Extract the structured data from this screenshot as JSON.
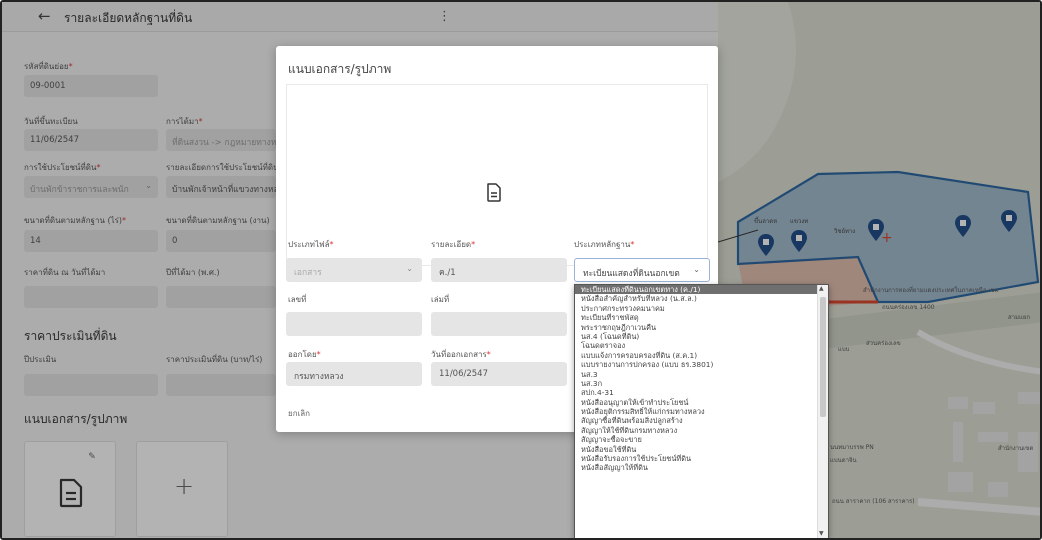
{
  "header": {
    "back_icon": "arrow-left-icon",
    "title": "รายละเอียดหลักฐานที่ดิน",
    "more_icon": "more-vertical-icon"
  },
  "form": {
    "parcel_code": {
      "label": "รหัสที่ดินย่อย",
      "value": "09-0001"
    },
    "register_date": {
      "label": "วันที่ขึ้นทะเบียน",
      "value": "11/06/2547"
    },
    "acquisition": {
      "label": "การได้มา",
      "value": "ที่ดินสงวน -> กฎหมายทางหลวง"
    },
    "land_use": {
      "label": "การใช้ประโยชน์ที่ดิน",
      "value": "บ้านพักข้าราชการและพนัก"
    },
    "land_use_detail": {
      "label": "รายละเอียดการใช้ประโยชน์ที่ดิน",
      "value": "บ้านพักเจ้าหน้าที่แขวงทางหลว"
    },
    "area_rai": {
      "label": "ขนาดที่ดินตามหลักฐาน (ไร่)",
      "value": "14"
    },
    "area_ngan": {
      "label": "ขนาดที่ดินตามหลักฐาน (งาน)",
      "value": "0"
    },
    "price_at_acq": {
      "label": "ราคาที่ดิน ณ วันที่ได้มา",
      "value": ""
    },
    "acq_year": {
      "label": "ปีที่ได้มา (พ.ศ.)",
      "value": ""
    },
    "appraisal_section": "ราคาประเมินที่ดิน",
    "appraisal_year": {
      "label": "ปีประเมิน",
      "value": ""
    },
    "appraisal_price": {
      "label": "ราคาประเมินที่ดิน (บาท/ไร่)",
      "value": ""
    },
    "attachments_section": "แนบเอกสาร/รูปภาพ",
    "doc_icon": "document-icon",
    "edit_icon": "pencil-icon",
    "add_icon": "plus-icon",
    "add_label": "+"
  },
  "dialog": {
    "title": "แนบเอกสาร/รูปภาพ",
    "preview_icon": "document-icon",
    "file_type": {
      "label": "ประเภทไฟล์",
      "value": "เอกสาร"
    },
    "detail": {
      "label": "รายละเอียด",
      "value": "ค./1"
    },
    "doc_type": {
      "label": "ประเภทหลักฐาน",
      "value": "ทะเบียนแสดงที่ดินนอกเขต"
    },
    "number": {
      "label": "เลขที่",
      "value": ""
    },
    "volume": {
      "label": "เล่มที่",
      "value": ""
    },
    "issued_by": {
      "label": "ออกโดย",
      "value": "กรมทางหลวง"
    },
    "issue_date": {
      "label": "วันที่ออกเอกสาร",
      "value": "11/06/2547"
    },
    "cancel": "ยกเลิก"
  },
  "dropdown": {
    "selected_index": 0,
    "options": [
      "ทะเบียนแสดงที่ดินนอกเขตทาง (ค./1)",
      "หนังสือสำคัญสำหรับที่หลวง (น.ส.ล.)",
      "ประกาศกระทรวงคมนาคม",
      "ทะเบียนที่ราชพัสดุ",
      "พระราชกฤษฎีกาเวนคืน",
      "นส.4 (โฉนดที่ดิน)",
      "โฉนดตราจอง",
      "แบบแจ้งการครอบครองที่ดิน (ส.ค.1)",
      "แบบรายงานการปกครอง (แบบ ธร.3801)",
      "นส.3",
      "นส.3ก",
      "สปก.4-31",
      "หนังสืออนุญาตให้เข้าทำประโยชน์",
      "หนังสือยุติกรรมสิทธิ์ให้แก่กรมทางหลวง",
      "สัญญาซื้อที่ดินพร้อมสิ่งปลูกสร้าง",
      "สัญญาให้ใช้ที่ดินกรมทางหลวง",
      "สัญญาจะซื้อจะขาย",
      "หนังสือขอใช้ที่ดิน",
      "หนังสือรับรองการใช้ประโยชน์ที่ดิน",
      "หนังสือสัญญาให้ที่ดิน"
    ]
  },
  "map": {
    "marker_icon": "map-pin-icon",
    "labels": [
      "ขึ้นลาดห",
      "แขวงท",
      "วิชย์ทาง",
      "สำนักงานการทองที่ยามแดงประเทศในภาคเหนือ เขต",
      "ถนนคร่องเลข 1400",
      "สามแยก",
      "ส่วนคร่องเลข",
      "แบบ",
      "นนทมาบรรพ PN",
      "แบนดาจิน",
      "ถนน สาราคาก (106 สาราคาร)",
      "สำนักงานเขต"
    ],
    "colors": {
      "polygon_fill": "#9fb9cf",
      "polygon_stroke": "#1f5f9f",
      "marker": "#1d4b86",
      "road_red": "#d9452b",
      "map_bg": "#dfe3d6"
    }
  }
}
